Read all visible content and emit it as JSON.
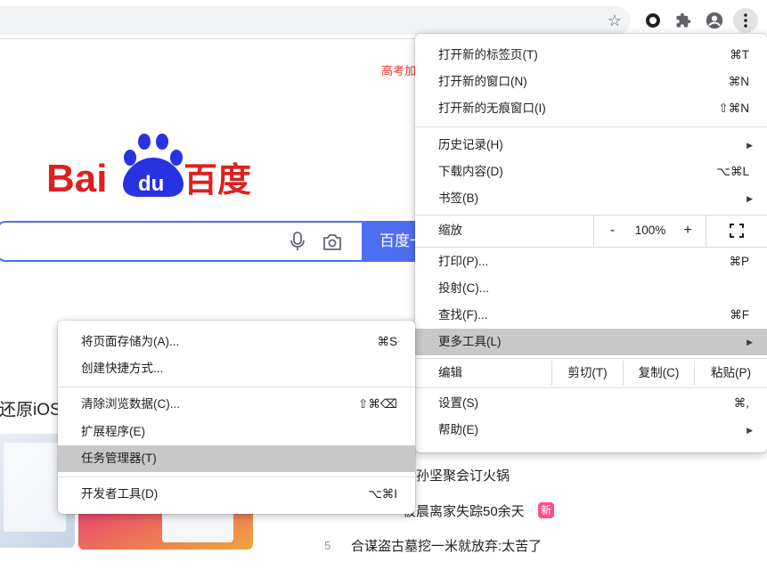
{
  "toolbar": {
    "bookmark_icon": "star-icon",
    "extension_icon": "ring-extension-icon",
    "extensions_icon": "puzzle-icon",
    "profile_icon": "profile-icon",
    "menu_icon": "kebab-menu-icon"
  },
  "page": {
    "top_link": "高考加",
    "logo_text": [
      "Bai",
      "du",
      "百度"
    ],
    "search_button": "百度一",
    "partial_heading": "还原iOS",
    "hot_list": [
      {
        "index": "",
        "text": "后孙坚聚会订火锅"
      },
      {
        "index": "",
        "text": "被晨离家失踪50余天",
        "badge": "新"
      },
      {
        "index": "5",
        "text": "合谋盗古墓挖一米就放弃:太苦了"
      }
    ],
    "colors": {
      "brand_red": "#de1f21",
      "brand_blue": "#2932e1",
      "search_blue": "#4e6ef2",
      "badge_pink": "#ff4f86"
    }
  },
  "main_menu": {
    "new_tab": {
      "label": "打开新的标签页(T)",
      "shortcut": "⌘T"
    },
    "new_window": {
      "label": "打开新的窗口(N)",
      "shortcut": "⌘N"
    },
    "new_incognito": {
      "label": "打开新的无痕窗口(I)",
      "shortcut": "⇧⌘N"
    },
    "history": {
      "label": "历史记录(H)"
    },
    "downloads": {
      "label": "下载内容(D)",
      "shortcut": "⌥⌘L"
    },
    "bookmarks": {
      "label": "书签(B)"
    },
    "zoom": {
      "label": "缩放",
      "minus": "-",
      "value": "100%",
      "plus": "+"
    },
    "print": {
      "label": "打印(P)...",
      "shortcut": "⌘P"
    },
    "cast": {
      "label": "投射(C)..."
    },
    "find": {
      "label": "查找(F)...",
      "shortcut": "⌘F"
    },
    "more_tools": {
      "label": "更多工具(L)"
    },
    "edit": {
      "label": "编辑",
      "cut": "剪切(T)",
      "copy": "复制(C)",
      "paste": "粘贴(P)"
    },
    "settings": {
      "label": "设置(S)",
      "shortcut": "⌘,"
    },
    "help": {
      "label": "帮助(E)"
    }
  },
  "sub_menu": {
    "save_page": {
      "label": "将页面存储为(A)...",
      "shortcut": "⌘S"
    },
    "create_shortcut": {
      "label": "创建快捷方式..."
    },
    "clear_data": {
      "label": "清除浏览数据(C)...",
      "shortcut": "⇧⌘⌫"
    },
    "extensions": {
      "label": "扩展程序(E)"
    },
    "task_manager": {
      "label": "任务管理器(T)"
    },
    "dev_tools": {
      "label": "开发者工具(D)",
      "shortcut": "⌥⌘I"
    }
  }
}
